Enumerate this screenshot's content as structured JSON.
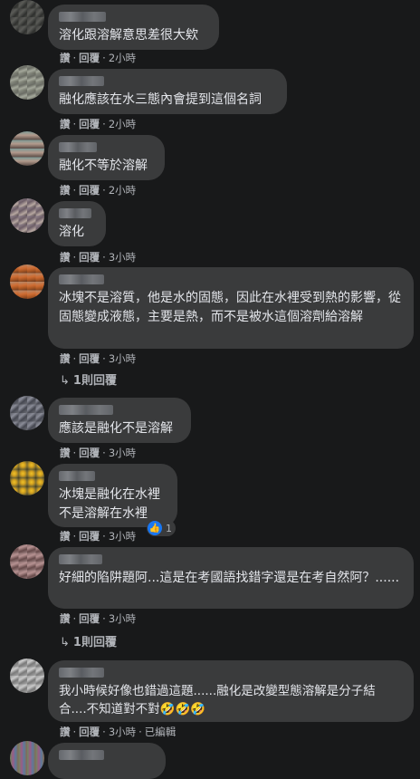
{
  "comments": [
    {
      "text": "溶化跟溶解意思差很大欸",
      "actions": {
        "like": "讚",
        "reply": "回覆",
        "time": "2小時"
      }
    },
    {
      "text": "融化應該在水三態內會提到這個名詞",
      "actions": {
        "like": "讚",
        "reply": "回覆",
        "time": "2小時"
      }
    },
    {
      "text": "融化不等於溶解",
      "actions": {
        "like": "讚",
        "reply": "回覆",
        "time": "2小時"
      }
    },
    {
      "text": "溶化",
      "actions": {
        "like": "讚",
        "reply": "回覆",
        "time": "3小時"
      }
    },
    {
      "text": "冰塊不是溶質，他是水的固態，因此在水裡受到熱的影響，從固態變成液態，主要是熱，而不是被水這個溶劑給溶解",
      "actions": {
        "like": "讚",
        "reply": "回覆",
        "time": "3小時"
      },
      "replies": "1則回覆"
    },
    {
      "text": "應該是融化不是溶解",
      "actions": {
        "like": "讚",
        "reply": "回覆",
        "time": "3小時"
      }
    },
    {
      "text": "冰塊是融化在水裡\n不是溶解在水裡",
      "actions": {
        "like": "讚",
        "reply": "回覆",
        "time": "3小時"
      },
      "reaction_count": "1"
    },
    {
      "text": "好細的陷阱題阿...這是在考國語找錯字還是在考自然阿？......",
      "actions": {
        "like": "讚",
        "reply": "回覆",
        "time": "3小時"
      },
      "replies": "1則回覆"
    },
    {
      "text": "我小時候好像也錯過這題......融化是改變型態溶解是分子結合....不知道對不對🤣🤣🤣",
      "actions": {
        "like": "讚",
        "reply": "回覆",
        "time": "3小時",
        "edited": "已編輯"
      }
    }
  ],
  "icons": {
    "reply_arrow": "reply-arrow-icon",
    "like": "thumbs-up-icon"
  },
  "colors": {
    "background": "#18191a",
    "bubble": "#3a3b3c",
    "text": "#e4e6eb",
    "meta": "#b0b3b8",
    "like_blue": "#1877f2"
  }
}
